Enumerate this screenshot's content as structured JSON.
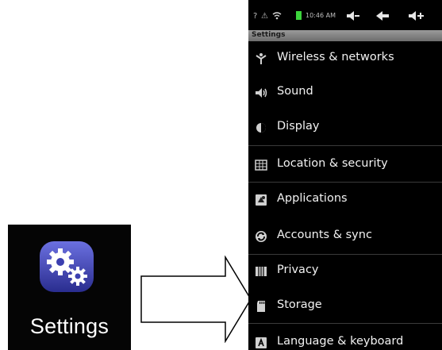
{
  "app": {
    "label": "Settings",
    "icon": "gears-icon",
    "icon_color": "#3b3fb0"
  },
  "status_bar": {
    "indicators": [
      "?",
      "⚠",
      "wifi",
      "battery",
      "sound",
      "back",
      "menu"
    ],
    "time": "10:46 AM"
  },
  "screen": {
    "title": "Settings"
  },
  "menu": [
    {
      "label": "Wireless & networks",
      "icon": "wifi-icon"
    },
    {
      "label": "Sound",
      "icon": "speaker-icon"
    },
    {
      "label": "Display",
      "icon": "display-icon"
    },
    {
      "label": "Location & security",
      "icon": "location-icon"
    },
    {
      "label": "Applications",
      "icon": "applications-icon"
    },
    {
      "label": "Accounts & sync",
      "icon": "sync-icon"
    },
    {
      "label": "Privacy",
      "icon": "privacy-icon"
    },
    {
      "label": "Storage",
      "icon": "storage-icon"
    },
    {
      "label": "Language & keyboard",
      "icon": "keyboard-icon"
    }
  ]
}
